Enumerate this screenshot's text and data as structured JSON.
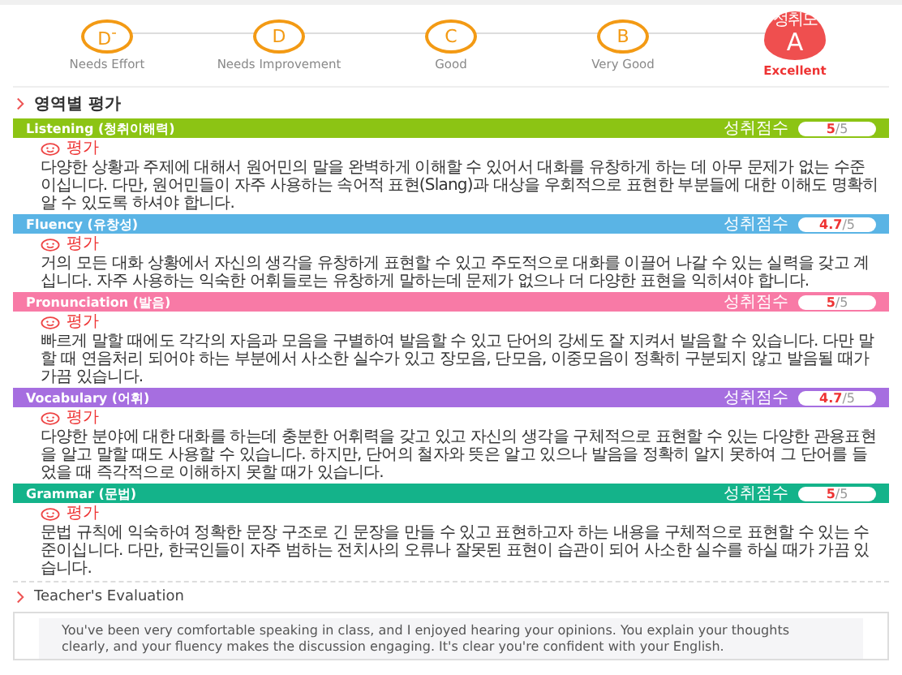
{
  "grades": [
    {
      "letter": "D$^{-}$",
      "label": "Needs Effort",
      "selected": false
    },
    {
      "letter": "D",
      "label": "Needs Improvement",
      "selected": false
    },
    {
      "letter": "C",
      "label": "Good",
      "selected": false
    },
    {
      "letter": "B",
      "label": "Very Good",
      "selected": false
    },
    {
      "letter": "A",
      "label": "Excellent",
      "selected": true,
      "caption": "성취도"
    }
  ],
  "section_title": "영역별 평가",
  "areas": [
    {
      "name": "Listening (청취이해력)",
      "color": "#8cc414",
      "score_label": "성취점수",
      "score": "5",
      "max": "/5",
      "eval_label": "평가",
      "text": "다양한 상황과 주제에 대해서 원어민의 말을 완벽하게 이해할 수 있어서 대화를 유창하게 하는 데 아무 문제가 없는 수준이십니다. 다만, 원어민들이 자주 사용하는 속어적 표현(Slang)과 대상을 우회적으로 표현한 부분들에 대한 이해도 명확히 알 수 있도록 하셔야 합니다."
    },
    {
      "name": "Fluency (유창성)",
      "color": "#5ab4e5",
      "score_label": "성취점수",
      "score": "4.7",
      "max": "/5",
      "eval_label": "평가",
      "text": "거의 모든 대화 상황에서 자신의 생각을 유창하게 표현할 수 있고 주도적으로 대화를 이끌어 나갈 수 있는 실력을 갖고 계십니다. 자주 사용하는 익숙한 어휘들로는 유창하게 말하는데 문제가 없으나 더 다양한 표현을 익히셔야 합니다."
    },
    {
      "name": "Pronunciation (발음)",
      "color": "#f87aa6",
      "score_label": "성취점수",
      "score": "5",
      "max": "/5",
      "eval_label": "평가",
      "text": "빠르게 말할 때에도 각각의 자음과 모음을 구별하여 발음할 수 있고 단어의 강세도 잘 지켜서 발음할 수 있습니다. 다만 말할 때 연음처리 되어야 하는 부분에서 사소한 실수가 있고 장모음, 단모음, 이중모음이 정확히 구분되지 않고 발음될 때가 가끔 있습니다."
    },
    {
      "name": "Vocabulary (어휘)",
      "color": "#a66ee0",
      "score_label": "성취점수",
      "score": "4.7",
      "max": "/5",
      "eval_label": "평가",
      "text": "다양한 분야에 대한 대화를 하는데 충분한 어휘력을 갖고 있고 자신의 생각을 구체적으로 표현할 수 있는 다양한 관용표현을 알고 말할 때도 사용할 수 있습니다. 하지만, 단어의 철자와 뜻은 알고 있으나 발음을 정확히 알지 못하여 그 단어를 들었을 때 즉각적으로 이해하지 못할 때가 있습니다."
    },
    {
      "name": "Grammar (문법)",
      "color": "#14b38a",
      "score_label": "성취점수",
      "score": "5",
      "max": "/5",
      "eval_label": "평가",
      "text": "문법 규칙에 익숙하여 정확한 문장 구조로 긴 문장을 만들 수 있고 표현하고자 하는 내용을 구체적으로 표현할 수 있는 수준이십니다. 다만, 한국인들이 자주 범하는 전치사의 오류나 잘못된 표현이 습관이 되어 사소한 실수를 하실 때가 가끔 있습니다."
    }
  ],
  "teacher": {
    "title": "Teacher's Evaluation",
    "text": "You've been very comfortable speaking in class, and I enjoyed hearing your opinions. You explain your thoughts clearly, and your fluency makes the discussion engaging. It's clear you're confident with your English."
  }
}
